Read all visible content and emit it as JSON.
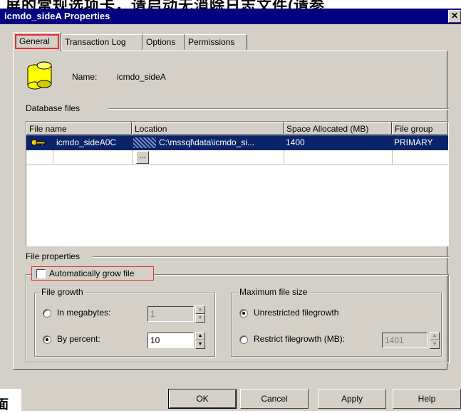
{
  "banner": {
    "text": "屏的常规选项卡，请启动无消除日志文件(请参"
  },
  "window": {
    "title": "icmdo_sideA Properties",
    "close_glyph": "✕"
  },
  "tabs": [
    {
      "label": "General",
      "active": true
    },
    {
      "label": "Transaction Log"
    },
    {
      "label": "Options"
    },
    {
      "label": "Permissions"
    }
  ],
  "database": {
    "name_label": "Name:",
    "name_value": "icmdo_sideA"
  },
  "database_files": {
    "section_label": "Database files",
    "columns": [
      "File name",
      "Location",
      "Space Allocated (MB)",
      "File group"
    ],
    "rows": [
      {
        "file_name": "icmdo_sideA0C",
        "location": "C:\\mssql\\data\\icmdo_si...",
        "space": "1400",
        "file_group": "PRIMARY"
      }
    ],
    "browse_label": "..."
  },
  "file_properties": {
    "section_label": "File properties",
    "auto_grow_label": "Automatically grow file",
    "file_growth": {
      "legend": "File growth",
      "in_megabytes_label": "In megabytes:",
      "in_megabytes_value": "1",
      "by_percent_label": "By percent:",
      "by_percent_value": "10",
      "selected": "by_percent"
    },
    "max_size": {
      "legend": "Maximum file size",
      "unrestricted_label": "Unrestricted filegrowth",
      "restrict_label": "Restrict filegrowth (MB):",
      "restrict_value": "1401",
      "selected": "unrestricted"
    }
  },
  "buttons": {
    "ok": "OK",
    "cancel": "Cancel",
    "apply": "Apply",
    "help": "Help"
  },
  "colors": {
    "title_bar": "#000080",
    "selection": "#0a246a",
    "highlight": "#e03030",
    "face": "#d4d0c8"
  },
  "icons": {
    "database": "database-cylinders-icon",
    "file_key": "key-icon"
  }
}
